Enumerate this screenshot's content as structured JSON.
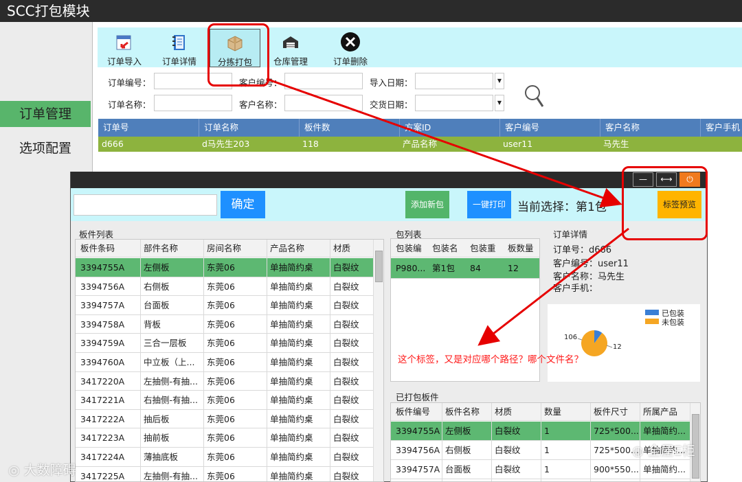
{
  "app": {
    "title": "SCC打包模块"
  },
  "nav": {
    "items": [
      {
        "label": "订单管理",
        "active": true
      },
      {
        "label": "选项配置",
        "active": false
      }
    ]
  },
  "toolbar": {
    "items": [
      {
        "label": "订单导入",
        "icon": "import-icon"
      },
      {
        "label": "订单详情",
        "icon": "notebook-icon"
      },
      {
        "label": "分拣打包",
        "icon": "box-icon",
        "selected": true
      },
      {
        "label": "仓库管理",
        "icon": "warehouse-icon"
      },
      {
        "label": "订单删除",
        "icon": "delete-icon"
      }
    ]
  },
  "filters": {
    "order_no": "订单编号：",
    "order_name": "订单名称：",
    "customer_no": "客户编号：",
    "customer_name": "客户名称：",
    "import_date": "导入日期：",
    "delivery_date": "交货日期："
  },
  "orders": {
    "columns": [
      "订单号",
      "订单名称",
      "板件数",
      "方案ID",
      "客户编号",
      "客户名称",
      "客户手机"
    ],
    "rows": [
      [
        "d666",
        "d马先生203",
        "118",
        "产品名称",
        "user11",
        "马先生",
        ""
      ]
    ]
  },
  "popup": {
    "confirm_label": "确定",
    "add_pack_label": "添加新包",
    "one_click_print_label": "一键打印",
    "current_selection": "当前选择：第1包",
    "label_preview_label": "标签预览",
    "minimize": "—",
    "restore": "⟷",
    "power": "⏻"
  },
  "board_list": {
    "title": "板件列表",
    "columns": [
      "板件条码",
      "部件名称",
      "房间名称",
      "产品名称",
      "材质"
    ],
    "rows": [
      [
        "3394755A",
        "左侧板",
        "东莞06",
        "单抽简约桌",
        "白裂纹"
      ],
      [
        "3394756A",
        "右侧板",
        "东莞06",
        "单抽简约桌",
        "白裂纹"
      ],
      [
        "3394757A",
        "台面板",
        "东莞06",
        "单抽简约桌",
        "白裂纹"
      ],
      [
        "3394758A",
        "背板",
        "东莞06",
        "单抽简约桌",
        "白裂纹"
      ],
      [
        "3394759A",
        "三合一层板",
        "东莞06",
        "单抽简约桌",
        "白裂纹"
      ],
      [
        "3394760A",
        "中立板（上...",
        "东莞06",
        "单抽简约桌",
        "白裂纹"
      ],
      [
        "3417220A",
        "左抽侧-有抽...",
        "东莞06",
        "单抽简约桌",
        "白裂纹"
      ],
      [
        "3417221A",
        "右抽侧-有抽...",
        "东莞06",
        "单抽简约桌",
        "白裂纹"
      ],
      [
        "3417222A",
        "抽后板",
        "东莞06",
        "单抽简约桌",
        "白裂纹"
      ],
      [
        "3417223A",
        "抽前板",
        "东莞06",
        "单抽简约桌",
        "白裂纹"
      ],
      [
        "3417224A",
        "薄抽底板",
        "东莞06",
        "单抽简约桌",
        "白裂纹"
      ],
      [
        "3417225A",
        "左抽侧-有抽...",
        "东莞06",
        "单抽简约桌",
        "白裂纹"
      ]
    ]
  },
  "pack_list": {
    "title": "包列表",
    "columns": [
      "包装编",
      "包装名",
      "包装重",
      "板数量"
    ],
    "rows": [
      [
        "P980...",
        "第1包",
        "84",
        "12"
      ]
    ]
  },
  "order_detail": {
    "title": "订单详情",
    "lines": [
      "订单号：d666",
      "客户编号：user11",
      "客户名称：马先生",
      "客户手机："
    ],
    "legend": [
      "已包装",
      "未包装"
    ],
    "pie_labels": [
      "106",
      "12"
    ]
  },
  "chart_data": {
    "type": "pie",
    "categories": [
      "已包装",
      "未包装"
    ],
    "values": [
      12,
      106
    ],
    "colors": [
      "#3a7fd5",
      "#f5a623"
    ]
  },
  "packed": {
    "title": "已打包板件",
    "columns": [
      "板件编号",
      "板件名称",
      "材质",
      "数量",
      "板件尺寸",
      "所属产品"
    ],
    "rows": [
      [
        "3394755A",
        "左侧板",
        "白裂纹",
        "1",
        "725*500...",
        "单抽简约..."
      ],
      [
        "3394756A",
        "右侧板",
        "白裂纹",
        "1",
        "725*500...",
        "单抽简约..."
      ],
      [
        "3394757A",
        "台面板",
        "白裂纹",
        "1",
        "900*550...",
        "单抽简约..."
      ]
    ]
  },
  "annotation": {
    "text": "这个标签，又是对应哪个路径？哪个文件名？"
  },
  "watermarks": {
    "left": "大数障碍",
    "right": "全屋E柜"
  }
}
